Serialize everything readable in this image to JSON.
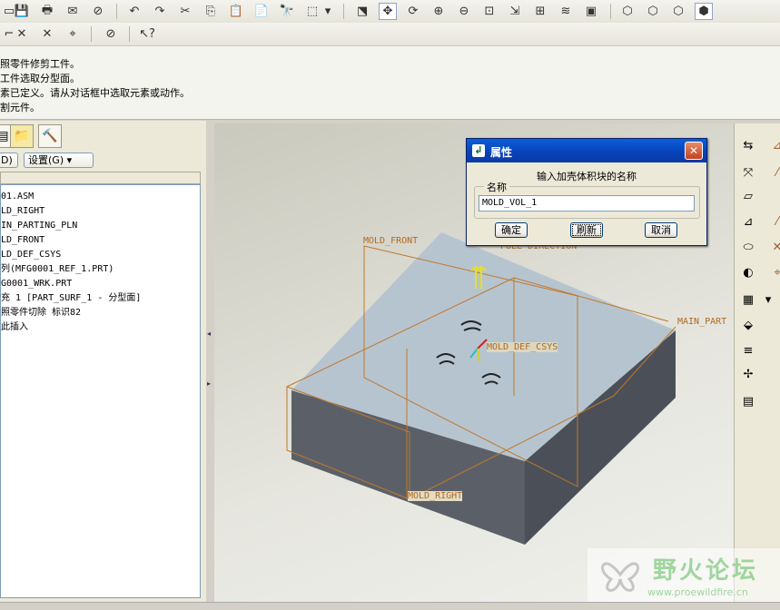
{
  "messages": [
    "照零件修剪工件。",
    "工件选取分型面。",
    "素已定义。请从对话框中选取元素或动作。",
    "割元件。"
  ],
  "left_panel": {
    "combo_left": "D) ▾",
    "combo_settings": "设置(G) ▾",
    "tree_items": [
      "01.ASM",
      "LD_RIGHT",
      "IN_PARTING_PLN",
      "LD_FRONT",
      "LD_DEF_CSYS",
      "列(MFG0001_REF_1.PRT)",
      "G0001_WRK.PRT",
      "充 1 [PART_SURF_1 - 分型面]",
      "照零件切除 标识82",
      "此插入"
    ]
  },
  "viewport": {
    "labels": {
      "mold_front": "MOLD_FRONT",
      "mold_right": "MOLD_RIGHT",
      "main_part": "MAIN_PART",
      "csys": "MOLD_DEF_CSYS",
      "pull_dir": "PULL DIRECTION"
    }
  },
  "dialog": {
    "title": "属性",
    "prompt": "输入加壳体积块的名称",
    "group_label": "名称",
    "name_value": "MOLD_VOL_1",
    "ok_label": "确定",
    "refresh_label": "刷新",
    "cancel_label": "取消"
  },
  "watermark": {
    "text": "野火论坛",
    "url": "www.proewildfire.cn"
  },
  "colors": {
    "title_bar": "#0a5fd8",
    "datum_orange": "#c0782c",
    "block_top": "#b6c4cf",
    "block_side": "#5b6068"
  }
}
